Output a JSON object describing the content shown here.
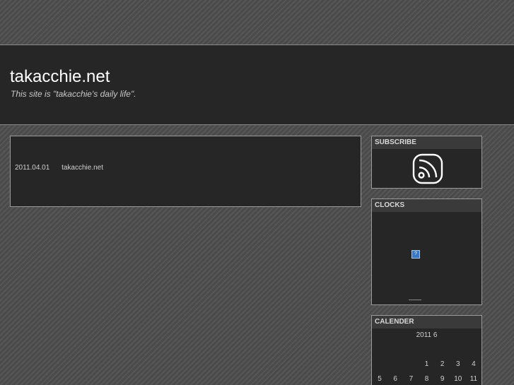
{
  "header": {
    "site_title": "takacchie.net",
    "site_description": "This site is \"takacchie's daily life\"."
  },
  "post": {
    "date": "2011.04.01",
    "site": "takacchie.net"
  },
  "sidebar": {
    "subscribe": {
      "title": "SUBSCRIBE",
      "icon": "rss-icon"
    },
    "clocks": {
      "title": "CLOCKS",
      "placeholder": "?"
    },
    "calendar": {
      "title": "CALENDER",
      "caption": "2011 6",
      "rows": [
        [
          "",
          "",
          "",
          "1",
          "2",
          "3",
          "4"
        ],
        [
          "5",
          "6",
          "7",
          "8",
          "9",
          "10",
          "11"
        ]
      ]
    }
  },
  "colors": {
    "background": "#4f4f4f",
    "panel": "#262626",
    "border": "#9a9a9a",
    "text": "#d0d0d0"
  }
}
